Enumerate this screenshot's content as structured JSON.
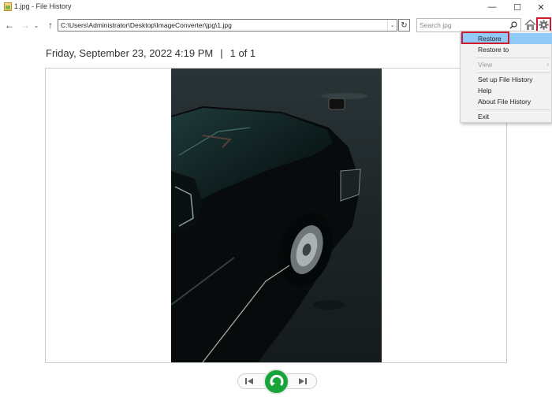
{
  "window": {
    "title": "1.jpg - File History",
    "minimize_glyph": "—",
    "maximize_glyph": "☐",
    "close_glyph": "✕"
  },
  "nav": {
    "back_glyph": "←",
    "forward_glyph": "→",
    "recent_glyph": "⌄",
    "up_glyph": "↑",
    "address": "C:\\Users\\Administrator\\Desktop\\ImageConverter\\jpg\\1.jpg",
    "address_dropdown_glyph": "⌄",
    "refresh_glyph": "↻",
    "search_placeholder": "Search jpg"
  },
  "heading": {
    "date": "Friday, September 23, 2022 4:19 PM",
    "separator": "|",
    "counter": "1 of 1"
  },
  "menu": {
    "items": [
      {
        "label": "Restore",
        "highlighted": true
      },
      {
        "label": "Restore to"
      },
      {
        "label": "View",
        "disabled": true,
        "submenu": true
      },
      {
        "label": "Set up File History"
      },
      {
        "label": "Help"
      },
      {
        "label": "About File History"
      },
      {
        "label": "Exit"
      }
    ],
    "submenu_glyph": "›"
  },
  "icons": {
    "app": "image-file-icon",
    "search": "search-icon",
    "home": "home-icon",
    "settings": "gear-icon",
    "previous": "skip-previous-icon",
    "restore": "restore-icon",
    "next": "skip-next-icon"
  },
  "colors": {
    "highlight": "#91c9f7",
    "annotation_outline": "#d0192b",
    "restore_button": "#17a53a"
  }
}
